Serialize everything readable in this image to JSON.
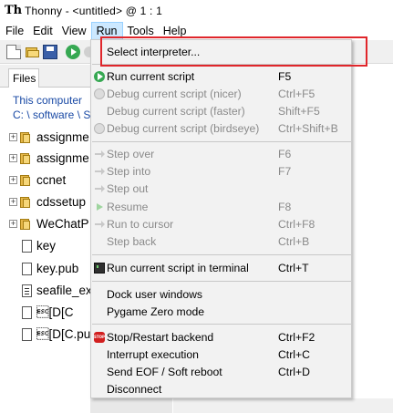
{
  "window": {
    "title": "Thonny  -  <untitled>  @  1 : 1",
    "app_icon": "Th"
  },
  "menubar": {
    "items": [
      "File",
      "Edit",
      "View",
      "Run",
      "Tools",
      "Help"
    ],
    "active": "Run"
  },
  "toolbar": {
    "icons": [
      "new-file-icon",
      "open-folder-icon",
      "save-icon",
      "run-icon",
      "debug-icon"
    ]
  },
  "files_pane": {
    "tab_label": "Files",
    "location_label": "This computer",
    "location_path": "C: \\ software \\ S",
    "items": [
      {
        "label": "assignme",
        "type": "folder",
        "expandable": true
      },
      {
        "label": "assignme",
        "type": "folder",
        "expandable": true
      },
      {
        "label": "ccnet",
        "type": "folder",
        "expandable": true
      },
      {
        "label": "cdssetup",
        "type": "folder",
        "expandable": true
      },
      {
        "label": "WeChatP",
        "type": "folder",
        "expandable": true
      },
      {
        "label": "key",
        "type": "file",
        "expandable": false
      },
      {
        "label": "key.pub",
        "type": "file",
        "expandable": false
      },
      {
        "label": "seafile_ex",
        "type": "text-file",
        "expandable": false
      },
      {
        "label": "\u001b[D[C",
        "type": "file",
        "expandable": false
      },
      {
        "label": "\u001b[D[C.pub",
        "type": "file",
        "expandable": false
      }
    ]
  },
  "run_menu": {
    "items": [
      {
        "label": "Select interpreter...",
        "shortcut": "",
        "enabled": true,
        "icon": ""
      },
      {
        "label": "Run current script",
        "shortcut": "F5",
        "enabled": true,
        "icon": "run-icon"
      },
      {
        "label": "Debug current script (nicer)",
        "shortcut": "Ctrl+F5",
        "enabled": false,
        "icon": "debug-icon"
      },
      {
        "label": "Debug current script (faster)",
        "shortcut": "Shift+F5",
        "enabled": false,
        "icon": ""
      },
      {
        "label": "Debug current script (birdseye)",
        "shortcut": "Ctrl+Shift+B",
        "enabled": false,
        "icon": "birdseye-icon"
      },
      {
        "label": "Step over",
        "shortcut": "F6",
        "enabled": false,
        "icon": "step-over-icon"
      },
      {
        "label": "Step into",
        "shortcut": "F7",
        "enabled": false,
        "icon": "step-into-icon"
      },
      {
        "label": "Step out",
        "shortcut": "",
        "enabled": false,
        "icon": "step-out-icon"
      },
      {
        "label": "Resume",
        "shortcut": "F8",
        "enabled": false,
        "icon": "resume-icon"
      },
      {
        "label": "Run to cursor",
        "shortcut": "Ctrl+F8",
        "enabled": false,
        "icon": "run-to-cursor-icon"
      },
      {
        "label": "Step back",
        "shortcut": "Ctrl+B",
        "enabled": false,
        "icon": ""
      },
      {
        "label": "Run current script in terminal",
        "shortcut": "Ctrl+T",
        "enabled": true,
        "icon": "terminal-icon"
      },
      {
        "label": "Dock user windows",
        "shortcut": "",
        "enabled": true,
        "icon": ""
      },
      {
        "label": "Pygame Zero mode",
        "shortcut": "",
        "enabled": true,
        "icon": ""
      },
      {
        "label": "Stop/Restart backend",
        "shortcut": "Ctrl+F2",
        "enabled": true,
        "icon": "stop-icon"
      },
      {
        "label": "Interrupt execution",
        "shortcut": "Ctrl+C",
        "enabled": true,
        "icon": ""
      },
      {
        "label": "Send EOF / Soft reboot",
        "shortcut": "Ctrl+D",
        "enabled": true,
        "icon": ""
      },
      {
        "label": "Disconnect",
        "shortcut": "",
        "enabled": true,
        "icon": ""
      }
    ]
  },
  "annotation": {
    "color": "#e0262b",
    "highlights": "Select interpreter..."
  },
  "colors": {
    "menu_highlight": "#cce8ff",
    "link_blue": "#1a4aa5",
    "disabled_text": "#8a8a8a",
    "run_green": "#36a852"
  }
}
